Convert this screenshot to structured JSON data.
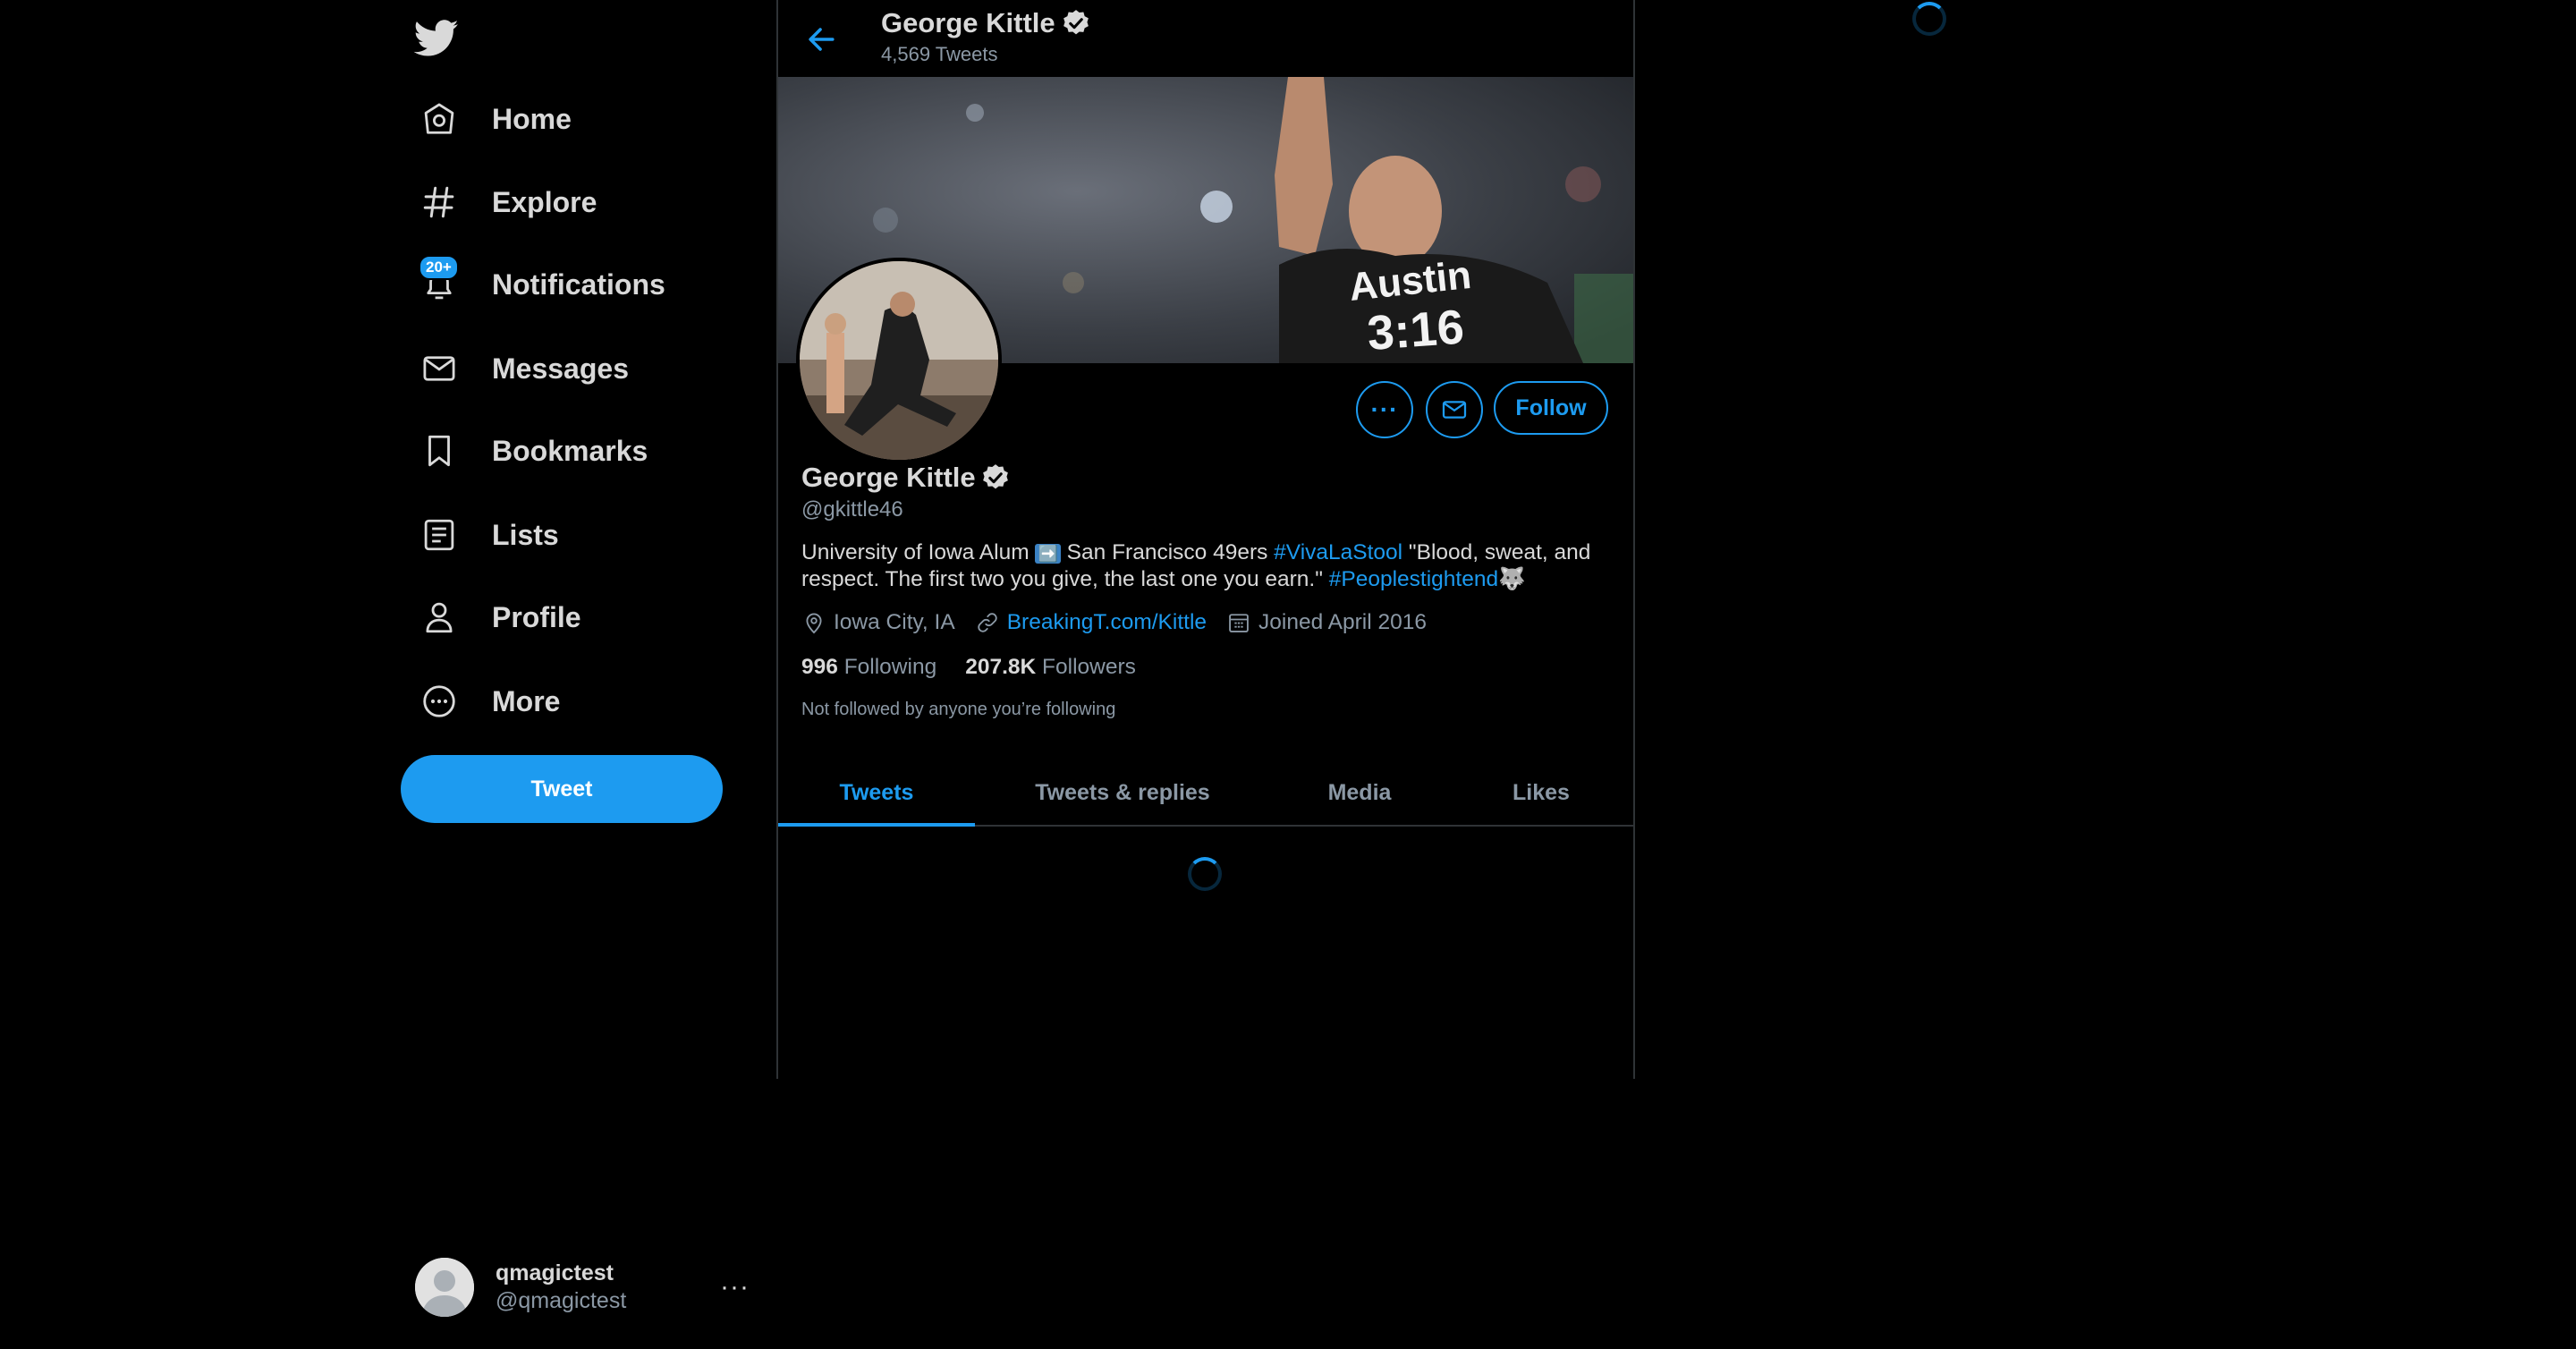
{
  "nav": {
    "items": [
      {
        "label": "Home",
        "icon": "home-icon"
      },
      {
        "label": "Explore",
        "icon": "hashtag-icon"
      },
      {
        "label": "Notifications",
        "icon": "bell-icon",
        "badge": "20+"
      },
      {
        "label": "Messages",
        "icon": "envelope-icon"
      },
      {
        "label": "Bookmarks",
        "icon": "bookmark-icon"
      },
      {
        "label": "Lists",
        "icon": "list-icon"
      },
      {
        "label": "Profile",
        "icon": "person-icon"
      },
      {
        "label": "More",
        "icon": "more-circle-icon"
      }
    ],
    "tweet_button": "Tweet"
  },
  "account": {
    "display_name": "qmagictest",
    "handle": "@qmagictest",
    "more": "···"
  },
  "header": {
    "name": "George Kittle",
    "tweet_count": "4,569 Tweets"
  },
  "profile": {
    "name": "George Kittle",
    "handle": "@gkittle46",
    "bio_parts": {
      "p1": "University of Iowa Alum ",
      "arrow": "➡️",
      "p2": " San Francisco 49ers ",
      "hash1": "#VivaLaStool",
      "p3": " \"Blood, sweat, and respect. The first two you give, the last one you earn.\" ",
      "hash2": "#Peoplestightend",
      "emoji": "🐺"
    },
    "location": "Iowa City, IA",
    "website": "BreakingT.com/Kittle",
    "joined": "Joined April 2016",
    "following_count": "996",
    "following_label": "Following",
    "followers_count": "207.8K",
    "followers_label": "Followers",
    "not_followed": "Not followed by anyone you’re following",
    "follow_button": "Follow",
    "more_button": "···"
  },
  "tabs": [
    "Tweets",
    "Tweets & replies",
    "Media",
    "Likes"
  ],
  "active_tab": "Tweets",
  "colors": {
    "accent": "#1d9bf0",
    "background": "#000000",
    "text_primary": "#d9d9d9",
    "text_secondary": "#8b98a5",
    "border": "#2f3336"
  }
}
